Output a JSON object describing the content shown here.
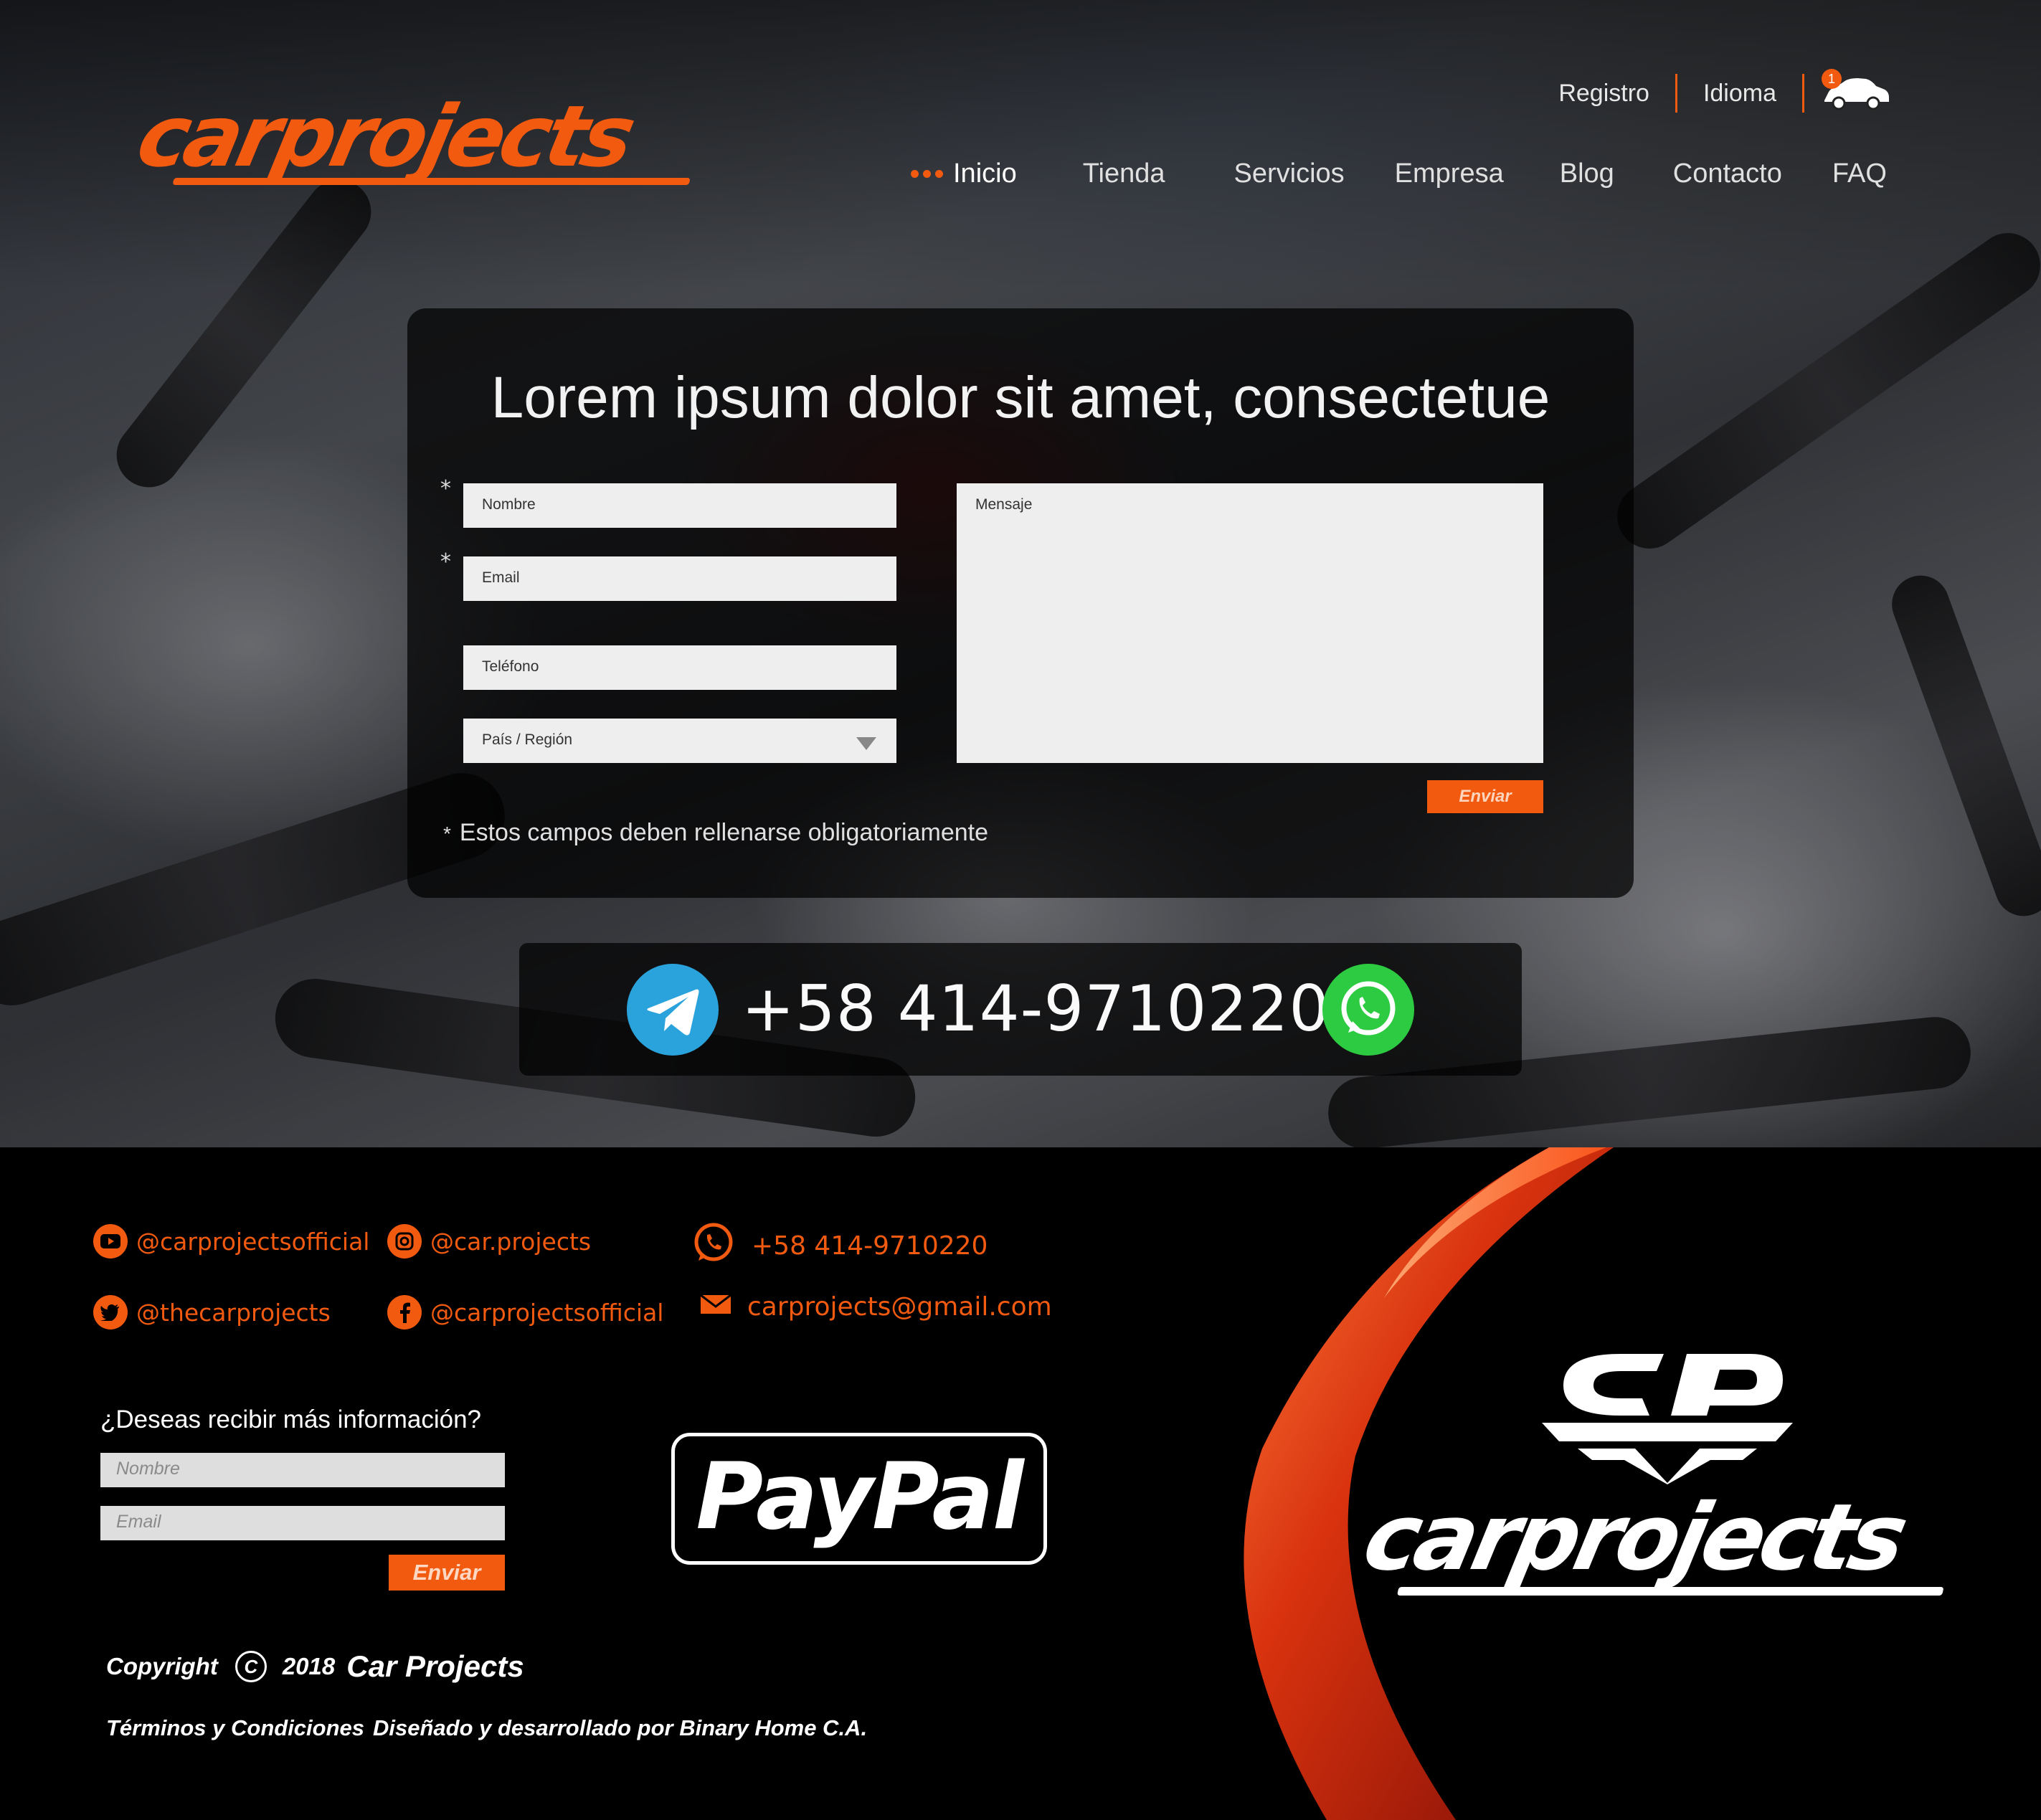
{
  "brand": {
    "logo_text": "carprojects",
    "accent": "#f25a10"
  },
  "topbar": {
    "register": "Registro",
    "language": "Idioma",
    "cart_count": "1"
  },
  "nav": [
    "Inicio",
    "Tienda",
    "Servicios",
    "Empresa",
    "Blog",
    "Contacto",
    "FAQ"
  ],
  "contact_form": {
    "title": "Lorem ipsum dolor sit amet, consectetue",
    "name_placeholder": "Nombre",
    "email_placeholder": "Email",
    "phone_placeholder": "Teléfono",
    "country_placeholder": "País / Región",
    "message_placeholder": "Mensaje",
    "submit_label": "Enviar",
    "required_mark": "*",
    "required_note": "Estos campos deben rellenarse obligatoriamente"
  },
  "phone_band": {
    "number": "+58 414-9710220",
    "left_icon": "telegram-icon",
    "right_icon": "whatsapp-icon"
  },
  "footer": {
    "social": {
      "youtube": "@carprojectsofficial",
      "instagram": "@car.projects",
      "twitter": "@thecarprojects",
      "facebook": "@carprojectsofficial"
    },
    "phone": "+58 414-9710220",
    "email": "carprojects@gmail.com",
    "newsletter": {
      "title": "¿Deseas recibir más información?",
      "name_placeholder": "Nombre",
      "email_placeholder": "Email",
      "submit_label": "Enviar"
    },
    "paypal_label": "PayPal",
    "copyright_label": "Copyright",
    "copyright_symbol": "C",
    "copyright_year": "2018",
    "company": "Car Projects",
    "terms": "Términos y Condiciones",
    "credits": "Diseñado y desarrollado por Binary Home C.A.",
    "logo_text": "carprojects"
  }
}
